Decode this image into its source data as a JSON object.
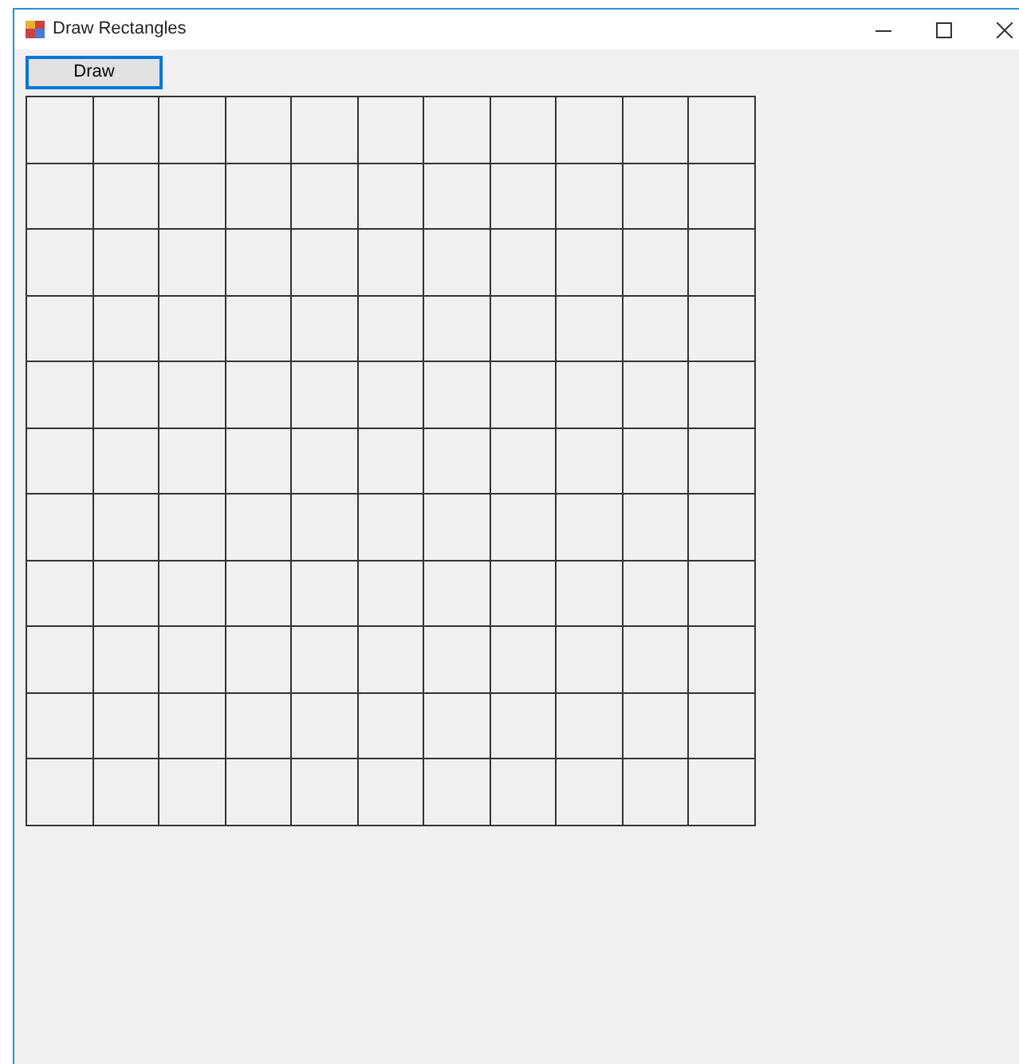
{
  "window": {
    "title": "Draw Rectangles"
  },
  "buttons": [
    {
      "label": "Draw",
      "focused": true
    }
  ]
}
